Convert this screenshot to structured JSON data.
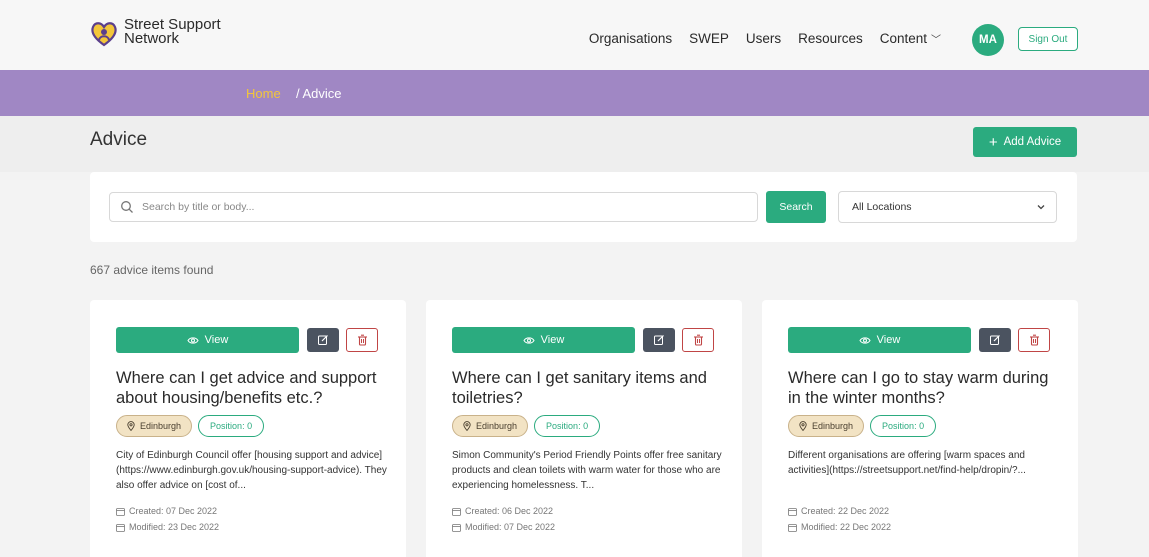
{
  "header": {
    "logo_line1": "Street Support",
    "logo_line2": "Network",
    "nav": [
      {
        "label": "Organisations"
      },
      {
        "label": "SWEP"
      },
      {
        "label": "Users"
      },
      {
        "label": "Resources"
      },
      {
        "label": "Content"
      }
    ],
    "avatar_initials": "MA",
    "sign_out_label": "Sign Out",
    "accent_color": "#2bab7f"
  },
  "breadcrumb": {
    "home": "Home",
    "current": "/ Advice",
    "bar_color": "#a087c4"
  },
  "page": {
    "title": "Advice",
    "add_button_label": "Add Advice"
  },
  "search": {
    "placeholder": "Search by title or body...",
    "button_label": "Search",
    "location_selected": "All Locations"
  },
  "results_count": "667 advice items found",
  "cards": [
    {
      "view_label": "View",
      "title": "Where can I get advice and support about housing/benefits etc.?",
      "location": "Edinburgh",
      "position": "Position: 0",
      "body": "City of Edinburgh Council offer [housing support and advice](https://www.edinburgh.gov.uk/housing-support-advice). They also offer advice on [cost of...",
      "created": "Created: 07 Dec 2022",
      "modified": "Modified: 23 Dec 2022"
    },
    {
      "view_label": "View",
      "title": "Where can I get sanitary items and toiletries?",
      "location": "Edinburgh",
      "position": "Position: 0",
      "body": "Simon Community's Period Friendly Points offer free sanitary products and clean toilets with warm water for those who are experiencing homelessness. T...",
      "created": "Created: 06 Dec 2022",
      "modified": "Modified: 07 Dec 2022"
    },
    {
      "view_label": "View",
      "title": "Where can I go to stay warm during in the winter months?",
      "location": "Edinburgh",
      "position": "Position: 0",
      "body": "Different organisations are offering [warm spaces and activities](https://streetsupport.net/find-help/dropin/?...",
      "created": "Created: 22 Dec 2022",
      "modified": "Modified: 22 Dec 2022"
    }
  ]
}
